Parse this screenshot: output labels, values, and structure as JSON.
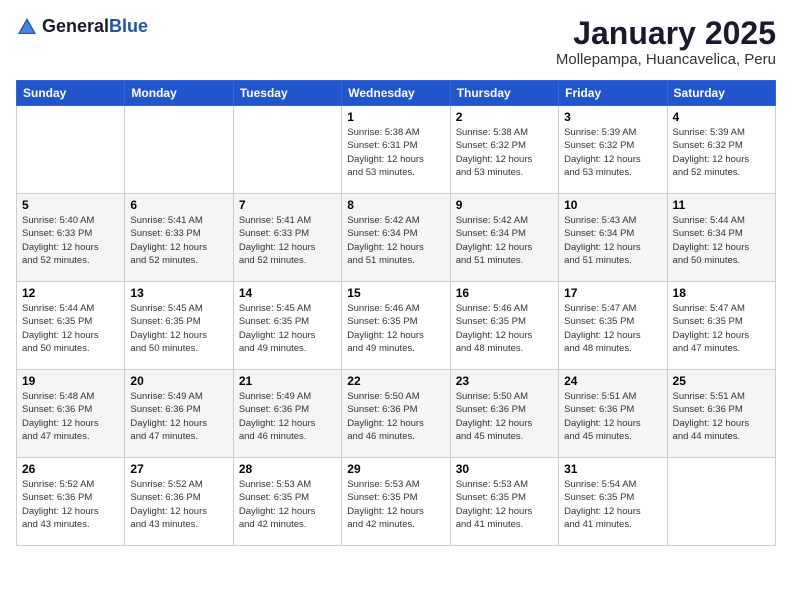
{
  "logo": {
    "general": "General",
    "blue": "Blue"
  },
  "header": {
    "month": "January 2025",
    "location": "Mollepampa, Huancavelica, Peru"
  },
  "weekdays": [
    "Sunday",
    "Monday",
    "Tuesday",
    "Wednesday",
    "Thursday",
    "Friday",
    "Saturday"
  ],
  "weeks": [
    [
      {
        "day": "",
        "info": ""
      },
      {
        "day": "",
        "info": ""
      },
      {
        "day": "",
        "info": ""
      },
      {
        "day": "1",
        "info": "Sunrise: 5:38 AM\nSunset: 6:31 PM\nDaylight: 12 hours\nand 53 minutes."
      },
      {
        "day": "2",
        "info": "Sunrise: 5:38 AM\nSunset: 6:32 PM\nDaylight: 12 hours\nand 53 minutes."
      },
      {
        "day": "3",
        "info": "Sunrise: 5:39 AM\nSunset: 6:32 PM\nDaylight: 12 hours\nand 53 minutes."
      },
      {
        "day": "4",
        "info": "Sunrise: 5:39 AM\nSunset: 6:32 PM\nDaylight: 12 hours\nand 52 minutes."
      }
    ],
    [
      {
        "day": "5",
        "info": "Sunrise: 5:40 AM\nSunset: 6:33 PM\nDaylight: 12 hours\nand 52 minutes."
      },
      {
        "day": "6",
        "info": "Sunrise: 5:41 AM\nSunset: 6:33 PM\nDaylight: 12 hours\nand 52 minutes."
      },
      {
        "day": "7",
        "info": "Sunrise: 5:41 AM\nSunset: 6:33 PM\nDaylight: 12 hours\nand 52 minutes."
      },
      {
        "day": "8",
        "info": "Sunrise: 5:42 AM\nSunset: 6:34 PM\nDaylight: 12 hours\nand 51 minutes."
      },
      {
        "day": "9",
        "info": "Sunrise: 5:42 AM\nSunset: 6:34 PM\nDaylight: 12 hours\nand 51 minutes."
      },
      {
        "day": "10",
        "info": "Sunrise: 5:43 AM\nSunset: 6:34 PM\nDaylight: 12 hours\nand 51 minutes."
      },
      {
        "day": "11",
        "info": "Sunrise: 5:44 AM\nSunset: 6:34 PM\nDaylight: 12 hours\nand 50 minutes."
      }
    ],
    [
      {
        "day": "12",
        "info": "Sunrise: 5:44 AM\nSunset: 6:35 PM\nDaylight: 12 hours\nand 50 minutes."
      },
      {
        "day": "13",
        "info": "Sunrise: 5:45 AM\nSunset: 6:35 PM\nDaylight: 12 hours\nand 50 minutes."
      },
      {
        "day": "14",
        "info": "Sunrise: 5:45 AM\nSunset: 6:35 PM\nDaylight: 12 hours\nand 49 minutes."
      },
      {
        "day": "15",
        "info": "Sunrise: 5:46 AM\nSunset: 6:35 PM\nDaylight: 12 hours\nand 49 minutes."
      },
      {
        "day": "16",
        "info": "Sunrise: 5:46 AM\nSunset: 6:35 PM\nDaylight: 12 hours\nand 48 minutes."
      },
      {
        "day": "17",
        "info": "Sunrise: 5:47 AM\nSunset: 6:35 PM\nDaylight: 12 hours\nand 48 minutes."
      },
      {
        "day": "18",
        "info": "Sunrise: 5:47 AM\nSunset: 6:35 PM\nDaylight: 12 hours\nand 47 minutes."
      }
    ],
    [
      {
        "day": "19",
        "info": "Sunrise: 5:48 AM\nSunset: 6:36 PM\nDaylight: 12 hours\nand 47 minutes."
      },
      {
        "day": "20",
        "info": "Sunrise: 5:49 AM\nSunset: 6:36 PM\nDaylight: 12 hours\nand 47 minutes."
      },
      {
        "day": "21",
        "info": "Sunrise: 5:49 AM\nSunset: 6:36 PM\nDaylight: 12 hours\nand 46 minutes."
      },
      {
        "day": "22",
        "info": "Sunrise: 5:50 AM\nSunset: 6:36 PM\nDaylight: 12 hours\nand 46 minutes."
      },
      {
        "day": "23",
        "info": "Sunrise: 5:50 AM\nSunset: 6:36 PM\nDaylight: 12 hours\nand 45 minutes."
      },
      {
        "day": "24",
        "info": "Sunrise: 5:51 AM\nSunset: 6:36 PM\nDaylight: 12 hours\nand 45 minutes."
      },
      {
        "day": "25",
        "info": "Sunrise: 5:51 AM\nSunset: 6:36 PM\nDaylight: 12 hours\nand 44 minutes."
      }
    ],
    [
      {
        "day": "26",
        "info": "Sunrise: 5:52 AM\nSunset: 6:36 PM\nDaylight: 12 hours\nand 43 minutes."
      },
      {
        "day": "27",
        "info": "Sunrise: 5:52 AM\nSunset: 6:36 PM\nDaylight: 12 hours\nand 43 minutes."
      },
      {
        "day": "28",
        "info": "Sunrise: 5:53 AM\nSunset: 6:35 PM\nDaylight: 12 hours\nand 42 minutes."
      },
      {
        "day": "29",
        "info": "Sunrise: 5:53 AM\nSunset: 6:35 PM\nDaylight: 12 hours\nand 42 minutes."
      },
      {
        "day": "30",
        "info": "Sunrise: 5:53 AM\nSunset: 6:35 PM\nDaylight: 12 hours\nand 41 minutes."
      },
      {
        "day": "31",
        "info": "Sunrise: 5:54 AM\nSunset: 6:35 PM\nDaylight: 12 hours\nand 41 minutes."
      },
      {
        "day": "",
        "info": ""
      }
    ]
  ]
}
